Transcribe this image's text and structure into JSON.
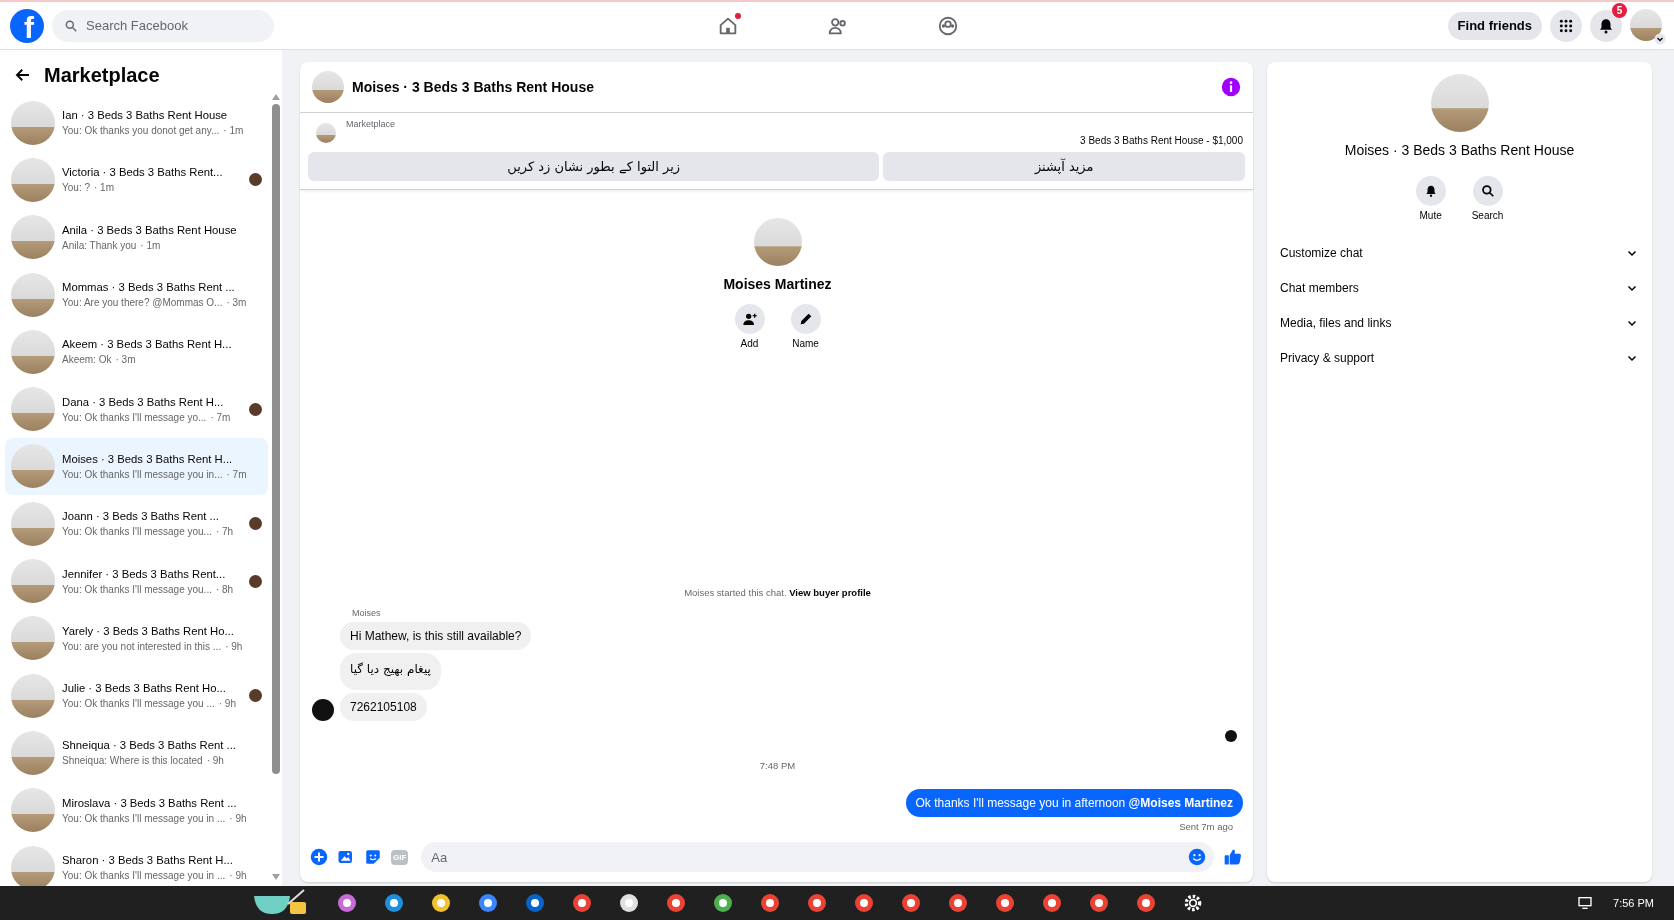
{
  "top_bar": {
    "logo": "f",
    "search": {
      "placeholder": "Search Facebook"
    },
    "nav": [
      {
        "kind": "home",
        "selected": false,
        "dot": true
      },
      {
        "kind": "friends",
        "selected": false
      },
      {
        "kind": "groups",
        "selected": false
      }
    ],
    "find_friends": "Find friends",
    "notification_count": "5"
  },
  "sidebar": {
    "title": "Marketplace",
    "conversations": [
      {
        "title": "Ian · 3 Beds 3 Baths Rent House",
        "preview": "You: Ok thanks you donot get any...",
        "time": "· 1m",
        "selected": false,
        "seen": false
      },
      {
        "title": "Victoria · 3 Beds 3 Baths Rent...",
        "preview": "You: ?",
        "time": "· 1m",
        "selected": false,
        "seen": true
      },
      {
        "title": "Anila · 3 Beds 3 Baths Rent House",
        "preview": "Anila: Thank you",
        "time": "· 1m",
        "selected": false,
        "seen": false
      },
      {
        "title": "Mommas · 3 Beds 3 Baths Rent ...",
        "preview": "You: Are you there? @Mommas O...",
        "time": "· 3m",
        "selected": false,
        "seen": false
      },
      {
        "title": "Akeem · 3 Beds 3 Baths Rent H...",
        "preview": "Akeem: Ok",
        "time": "· 3m",
        "selected": false,
        "seen": false
      },
      {
        "title": "Dana · 3 Beds 3 Baths Rent H...",
        "preview": "You: Ok thanks I'll message yo...",
        "time": "· 7m",
        "selected": false,
        "seen": true
      },
      {
        "title": "Moises · 3 Beds 3 Baths Rent H...",
        "preview": "You: Ok thanks I'll message you in...",
        "time": "· 7m",
        "selected": true,
        "seen": false
      },
      {
        "title": "Joann · 3 Beds 3 Baths Rent ...",
        "preview": "You: Ok thanks I'll message you...",
        "time": "· 7h",
        "selected": false,
        "seen": true
      },
      {
        "title": "Jennifer · 3 Beds 3 Baths Rent...",
        "preview": "You: Ok thanks I'll message you...",
        "time": "· 8h",
        "selected": false,
        "seen": true
      },
      {
        "title": "Yarely · 3 Beds 3 Baths Rent Ho...",
        "preview": "You: are you not interested in this ...",
        "time": "· 9h",
        "selected": false,
        "seen": false
      },
      {
        "title": "Julie · 3 Beds 3 Baths Rent Ho...",
        "preview": "You: Ok thanks I'll message you ...",
        "time": "· 9h",
        "selected": false,
        "seen": true
      },
      {
        "title": "Shneiqua · 3 Beds 3 Baths Rent ...",
        "preview": "Shneiqua: Where is this located",
        "time": "· 9h",
        "selected": false,
        "seen": false
      },
      {
        "title": "Miroslava · 3 Beds 3 Baths Rent ...",
        "preview": "You: Ok thanks I'll message you in ...",
        "time": "· 9h",
        "selected": false,
        "seen": false
      },
      {
        "title": "Sharon · 3 Beds 3 Baths Rent H...",
        "preview": "You: Ok thanks I'll message you in ...",
        "time": "· 9h",
        "selected": false,
        "seen": false
      }
    ]
  },
  "chat": {
    "title": "Moises · 3 Beds 3 Baths Rent House",
    "listing": {
      "source": "Marketplace",
      "summary": "3 Beds 3 Baths Rent House - $1,000",
      "actions": [
        "مزید آپشنز",
        "زیر التوا کے بطور نشان زد کریں"
      ]
    },
    "profile": {
      "name": "Moises Martinez",
      "actions": [
        {
          "kind": "add",
          "label": "Add"
        },
        {
          "kind": "name",
          "label": "Name"
        }
      ]
    },
    "started_notice": "Moises started this chat.",
    "buyer_profile_link": "View buyer profile",
    "messages": [
      {
        "kind": "incoming",
        "sender": "Moises",
        "text": "Hi Mathew, is this still available?"
      },
      {
        "kind": "incoming",
        "text": "پیغام بھیج دیا گیا",
        "rtl": true
      },
      {
        "kind": "incoming",
        "text": "7262105108",
        "avatar": true
      },
      {
        "kind": "seen"
      },
      {
        "kind": "time",
        "text": "7:48 PM"
      },
      {
        "kind": "outgoing",
        "text": "Ok thanks I'll message you in afternoon **@Moises Martinez**",
        "status": "Sent 7m ago"
      }
    ],
    "composer": {
      "gif_label": "GIF",
      "placeholder": "Aa"
    }
  },
  "details": {
    "title": "Moises · 3 Beds 3 Baths Rent House",
    "actions": [
      {
        "kind": "mute",
        "label": "Mute"
      },
      {
        "kind": "search",
        "label": "Search"
      }
    ],
    "sections": [
      {
        "label": "Customize chat",
        "expanded": false
      },
      {
        "label": "Chat members",
        "expanded": false
      },
      {
        "label": "Media, files and links",
        "expanded": false
      },
      {
        "label": "Privacy & support",
        "expanded": false
      }
    ]
  },
  "taskbar": {
    "clock": "7:56 PM"
  }
}
